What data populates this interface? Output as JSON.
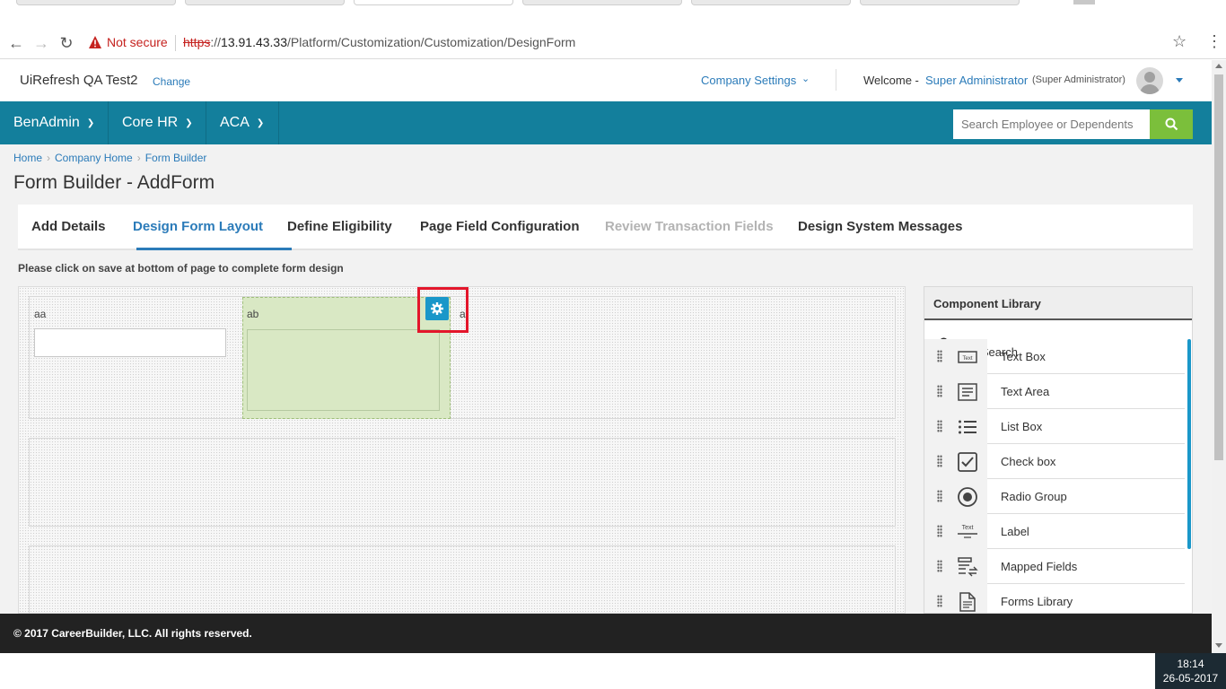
{
  "browser": {
    "security_label": "Not secure",
    "url_protocol": "https",
    "url_host": "13.91.43.33",
    "url_path": "/Platform/Customization/Customization/DesignForm"
  },
  "header": {
    "company_name": "UiRefresh QA Test2",
    "change_link": "Change",
    "company_settings": "Company Settings",
    "welcome_label": "Welcome -",
    "user_name": "Super Administrator",
    "user_role": "(Super Administrator)"
  },
  "nav": {
    "items": [
      {
        "label": "BenAdmin"
      },
      {
        "label": "Core HR"
      },
      {
        "label": "ACA"
      }
    ],
    "search_placeholder": "Search Employee or Dependents"
  },
  "breadcrumb": [
    "Home",
    "Company Home",
    "Form Builder"
  ],
  "page_title": "Form Builder - AddForm",
  "tabs": [
    {
      "label": "Add Details",
      "state": "normal"
    },
    {
      "label": "Design Form Layout",
      "state": "active"
    },
    {
      "label": "Define Eligibility",
      "state": "normal"
    },
    {
      "label": "Page Field Configuration",
      "state": "normal"
    },
    {
      "label": "Review Transaction Fields",
      "state": "disabled"
    },
    {
      "label": "Design System Messages",
      "state": "normal"
    }
  ],
  "hint_text": "Please click on save at bottom of page to complete form design",
  "canvas": {
    "fields": [
      {
        "label": "aa"
      },
      {
        "label": "ab"
      },
      {
        "label": "a"
      }
    ]
  },
  "component_library": {
    "title": "Component Library",
    "quick_search_label": "Quick Search",
    "items": [
      {
        "label": "Text Box",
        "icon": "text-box-icon"
      },
      {
        "label": "Text Area",
        "icon": "text-area-icon"
      },
      {
        "label": "List Box",
        "icon": "list-box-icon"
      },
      {
        "label": "Check box",
        "icon": "checkbox-icon"
      },
      {
        "label": "Radio Group",
        "icon": "radio-group-icon"
      },
      {
        "label": "Label",
        "icon": "label-icon"
      },
      {
        "label": "Mapped Fields",
        "icon": "mapped-fields-icon"
      },
      {
        "label": "Forms Library",
        "icon": "forms-library-icon"
      }
    ]
  },
  "footer": {
    "copyright": "© 2017 CareerBuilder, LLC. All rights reserved."
  },
  "taskbar": {
    "time": "18:14",
    "date": "26-05-2017"
  },
  "colors": {
    "nav_bg": "#137f9c",
    "link": "#2b7bb9",
    "search_button": "#7bbf3b",
    "selected_field": "#d9e8c4",
    "highlight_box": "#e3162b",
    "gear_button": "#1a97c9"
  }
}
